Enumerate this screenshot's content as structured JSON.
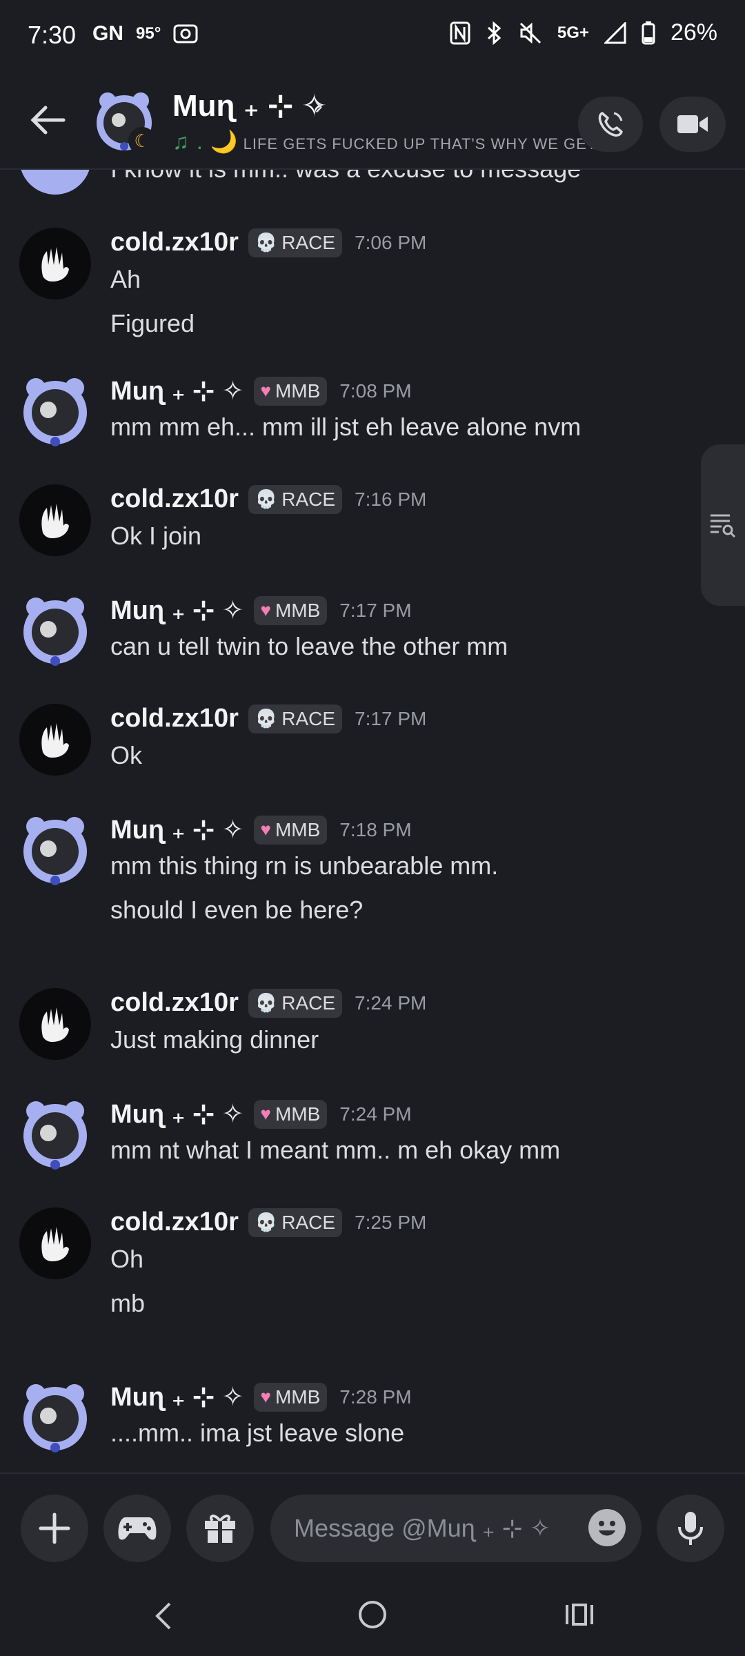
{
  "status_bar": {
    "time": "7:30",
    "left_icons": [
      "GN",
      "95°"
    ],
    "network": "5G+",
    "battery": "26%"
  },
  "header": {
    "name": "Muɳ ₊ ⊹ ✧",
    "status_text": "LIFE GETS FUCKED UP THAT'S WHY WE GET...",
    "status_prefix": "♫ . 🌙"
  },
  "partial_line": "I know it is mm.. was a excuse to message",
  "messages": [
    {
      "author": "cold.zx10r",
      "tag": "RACE",
      "time": "7:06 PM",
      "lines": [
        "Ah",
        "Figured"
      ]
    },
    {
      "author": "Muɳ ₊ ⊹ ✧",
      "tag": "MMB",
      "time": "7:08 PM",
      "lines": [
        "mm mm eh... mm ill jst eh leave alone nvm"
      ]
    },
    {
      "author": "cold.zx10r",
      "tag": "RACE",
      "time": "7:16 PM",
      "lines": [
        "Ok I join"
      ]
    },
    {
      "author": "Muɳ ₊ ⊹ ✧",
      "tag": "MMB",
      "time": "7:17 PM",
      "lines": [
        "can u tell twin to leave the other mm"
      ]
    },
    {
      "author": "cold.zx10r",
      "tag": "RACE",
      "time": "7:17 PM",
      "lines": [
        "Ok"
      ]
    },
    {
      "author": "Muɳ ₊ ⊹ ✧",
      "tag": "MMB",
      "time": "7:18 PM",
      "lines": [
        "mm this thing rn is unbearable mm.",
        "should I even be here?"
      ]
    },
    {
      "author": "cold.zx10r",
      "tag": "RACE",
      "time": "7:24 PM",
      "lines": [
        "Just making dinner"
      ]
    },
    {
      "author": "Muɳ ₊ ⊹ ✧",
      "tag": "MMB",
      "time": "7:24 PM",
      "lines": [
        "mm nt what I meant mm.. m eh okay mm"
      ]
    },
    {
      "author": "cold.zx10r",
      "tag": "RACE",
      "time": "7:25 PM",
      "lines": [
        "Oh",
        "mb"
      ]
    },
    {
      "author": "Muɳ ₊ ⊹ ✧",
      "tag": "MMB",
      "time": "7:28 PM",
      "lines": [
        "....mm.. ima jst leave slone"
      ]
    }
  ],
  "composer": {
    "placeholder": "Message @Muɳ ₊ ⊹ ✧"
  },
  "icons": [
    "back-arrow-icon",
    "phone-icon",
    "video-camera-icon",
    "search-list-icon",
    "plus-icon",
    "gamepad-icon",
    "gift-icon",
    "emoji-icon",
    "microphone-icon",
    "nav-back-icon",
    "nav-home-icon",
    "nav-recents-icon"
  ]
}
